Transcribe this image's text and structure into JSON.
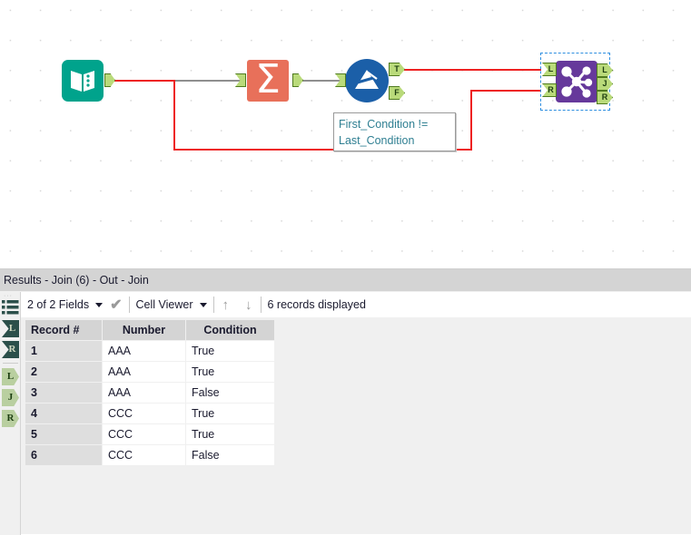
{
  "canvas": {
    "tools": [
      {
        "id": "text-input",
        "name": "text-input-tool",
        "icon": "book-icon",
        "color": "#00a38c"
      },
      {
        "id": "summarize",
        "name": "summarize-tool",
        "icon": "sigma-icon",
        "glyph": "Σ",
        "color": "#e8705a"
      },
      {
        "id": "filter",
        "name": "filter-tool",
        "icon": "funnel-icon",
        "color": "#1b5fa8"
      },
      {
        "id": "join",
        "name": "join-tool",
        "icon": "network-icon",
        "color": "#66399b"
      }
    ],
    "anchors": {
      "filter_true": "T",
      "filter_false": "F",
      "join_in_left": "L",
      "join_in_right": "R",
      "join_out_left": "L",
      "join_out_join": "J",
      "join_out_right": "R"
    },
    "annotation": {
      "line1": "First_Condition !=",
      "line2": "Last_Condition"
    },
    "wire_colors": {
      "selected": "#ee2222",
      "normal": "#8f8f8f"
    }
  },
  "results": {
    "title": "Results - Join (6) - Out - Join",
    "toolbar": {
      "fields_label": "2 of 2 Fields",
      "viewer_label": "Cell Viewer",
      "up_icon": "↑",
      "down_icon": "↓",
      "check_icon": "✔",
      "records_label": "6 records displayed"
    },
    "rail": {
      "list_icon": "list-icon",
      "dots_icon": "···",
      "items": [
        {
          "label": "L",
          "kind": "dark",
          "name": "rail-input-left"
        },
        {
          "label": "R",
          "kind": "dark",
          "name": "rail-input-right"
        },
        {
          "label": "L",
          "kind": "light",
          "name": "rail-output-left"
        },
        {
          "label": "J",
          "kind": "light",
          "name": "rail-output-join",
          "selected": true
        },
        {
          "label": "R",
          "kind": "light",
          "name": "rail-output-right"
        }
      ]
    },
    "table": {
      "columns": [
        "Record #",
        "Number",
        "Condition"
      ],
      "rows": [
        [
          "1",
          "AAA",
          "True"
        ],
        [
          "2",
          "AAA",
          "True"
        ],
        [
          "3",
          "AAA",
          "False"
        ],
        [
          "4",
          "CCC",
          "True"
        ],
        [
          "5",
          "CCC",
          "True"
        ],
        [
          "6",
          "CCC",
          "False"
        ]
      ]
    }
  }
}
